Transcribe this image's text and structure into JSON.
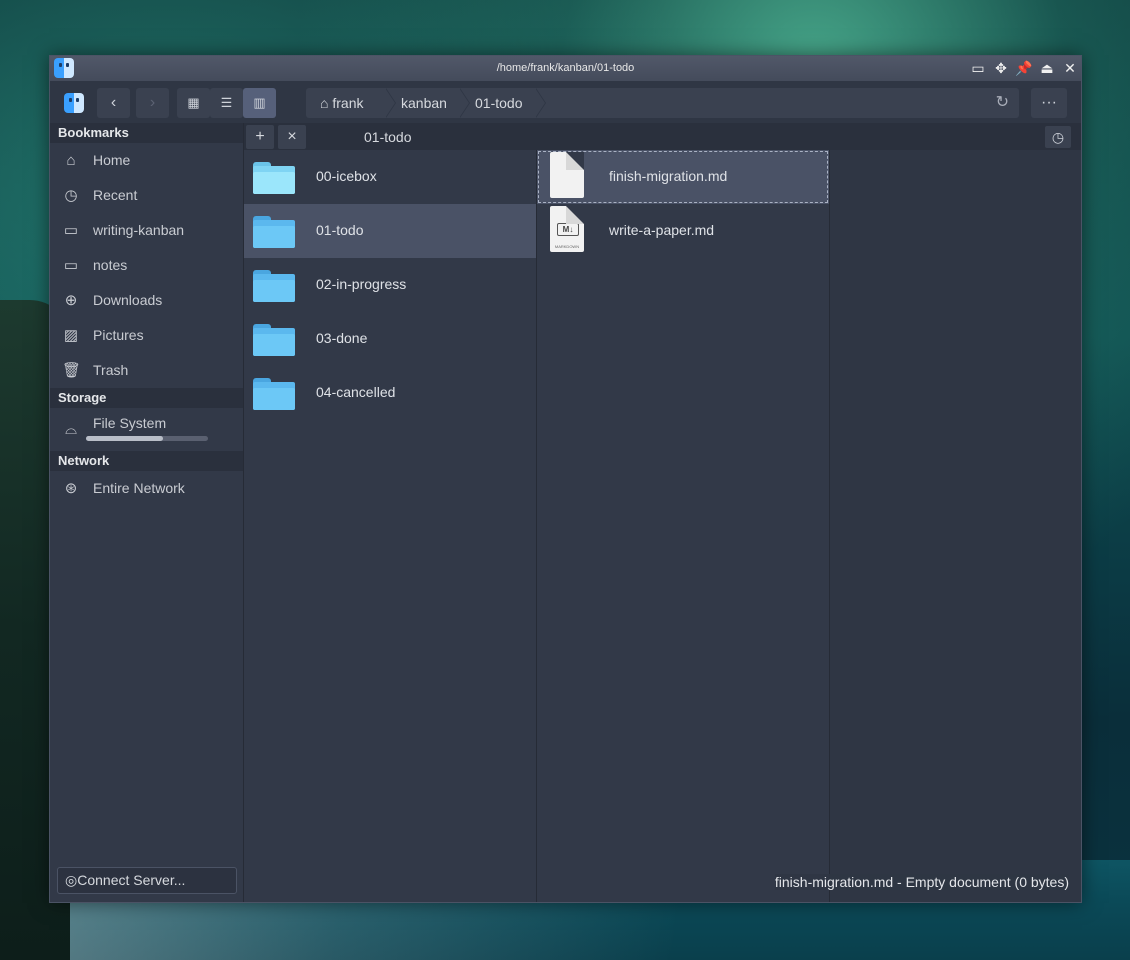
{
  "window": {
    "title": "/home/frank/kanban/01-todo"
  },
  "toolbar": {
    "breadcrumb": [
      "frank",
      "kanban",
      "01-todo"
    ],
    "more_label": "···"
  },
  "sidebar": {
    "bookmarks_header": "Bookmarks",
    "bookmarks": [
      {
        "label": "Home",
        "icon": "home-icon"
      },
      {
        "label": "Recent",
        "icon": "clock-icon"
      },
      {
        "label": "writing-kanban",
        "icon": "folder-icon"
      },
      {
        "label": "notes",
        "icon": "folder-icon"
      },
      {
        "label": "Downloads",
        "icon": "download-icon"
      },
      {
        "label": "Pictures",
        "icon": "image-icon"
      },
      {
        "label": "Trash",
        "icon": "trash-icon"
      }
    ],
    "storage_header": "Storage",
    "storage": [
      {
        "label": "File System",
        "icon": "drive-icon",
        "usage_fraction": 0.63
      }
    ],
    "network_header": "Network",
    "network": [
      {
        "label": "Entire Network",
        "icon": "network-icon"
      }
    ],
    "connect_label": "Connect Server..."
  },
  "tabbar": {
    "tab_title": "01-todo",
    "add_label": "+",
    "close_label": "×"
  },
  "columns": {
    "kanban": [
      {
        "label": "00-icebox"
      },
      {
        "label": "01-todo"
      },
      {
        "label": "02-in-progress"
      },
      {
        "label": "03-done"
      },
      {
        "label": "04-cancelled"
      }
    ],
    "todo": [
      {
        "label": "finish-migration.md"
      },
      {
        "label": "write-a-paper.md",
        "badge": "M↓",
        "caption": "MARKDOWN"
      }
    ]
  },
  "status": {
    "text": "finish-migration.md - Empty document (0 bytes)"
  },
  "colors": {
    "accent": "#56607a",
    "selection": "#4a5266",
    "folder": "#5bb8ee"
  }
}
